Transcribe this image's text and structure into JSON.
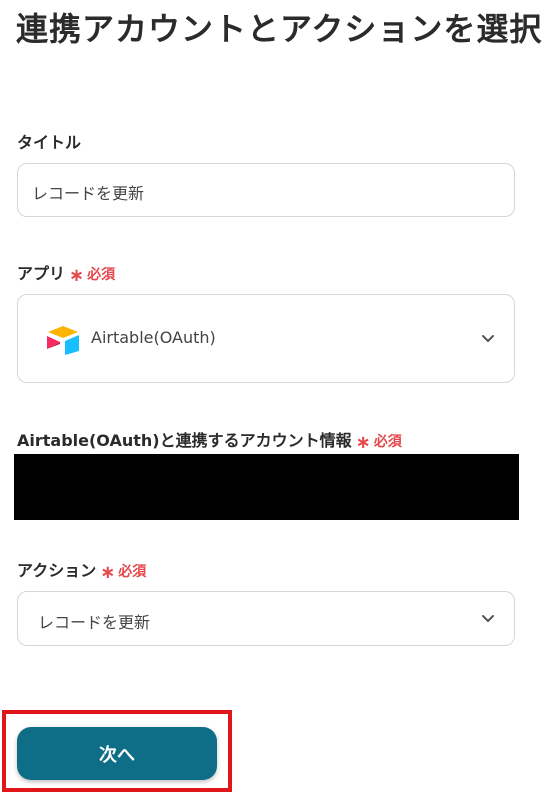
{
  "page": {
    "title": "連携アカウントとアクションを選択"
  },
  "title_field": {
    "label": "タイトル",
    "value": "レコードを更新"
  },
  "app_field": {
    "label": "アプリ",
    "required": "必須",
    "value": "Airtable(OAuth)",
    "icon": "airtable-logo-icon"
  },
  "account_field": {
    "label": "Airtable(OAuth)と連携するアカウント情報",
    "required": "必須"
  },
  "action_field": {
    "label": "アクション",
    "required": "必須",
    "value": "レコードを更新"
  },
  "next_button": {
    "label": "次へ"
  },
  "colors": {
    "accent": "#0f6e87",
    "required": "#e5484d",
    "highlight_frame": "#e0161b"
  }
}
